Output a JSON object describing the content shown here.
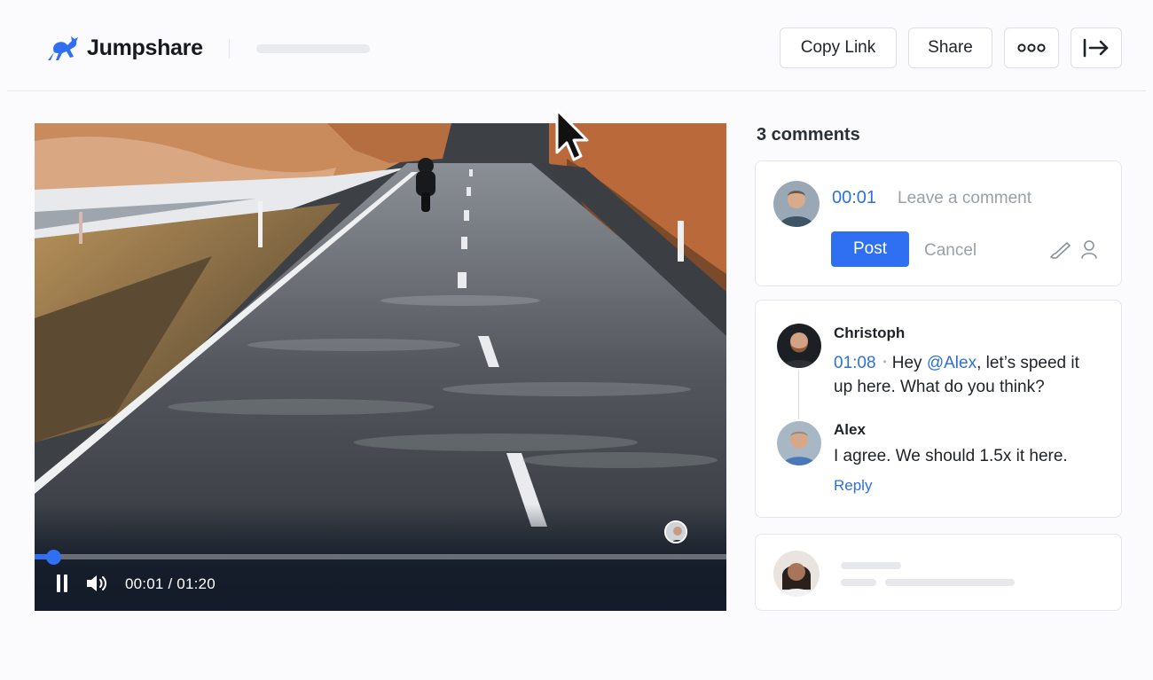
{
  "app": {
    "brand_name": "Jumpshare",
    "logo_icon": "kangaroo-icon",
    "accent_color": "#2f6ff2"
  },
  "header": {
    "copy_link_label": "Copy Link",
    "share_label": "Share",
    "more_icon": "more-horizontal-icon",
    "exit_icon": "exit-arrow-icon"
  },
  "player": {
    "time_current": "00:01",
    "time_total": "01:20",
    "time_readout": "00:01 / 01:20",
    "progress_fraction": 0.02,
    "state": "playing"
  },
  "comments": {
    "count_label": "3 comments",
    "compose": {
      "timestamp": "00:01",
      "placeholder": "Leave a comment",
      "post_label": "Post",
      "cancel_label": "Cancel"
    },
    "thread": [
      {
        "author": "Christoph",
        "timestamp": "01:08",
        "text_before": "Hey ",
        "mention": "@Alex",
        "text_after": ", let’s speed it up here. What do you think?"
      },
      {
        "author": "Alex",
        "text": "I agree. We should 1.5x it here.",
        "reply_label": "Reply"
      }
    ]
  }
}
